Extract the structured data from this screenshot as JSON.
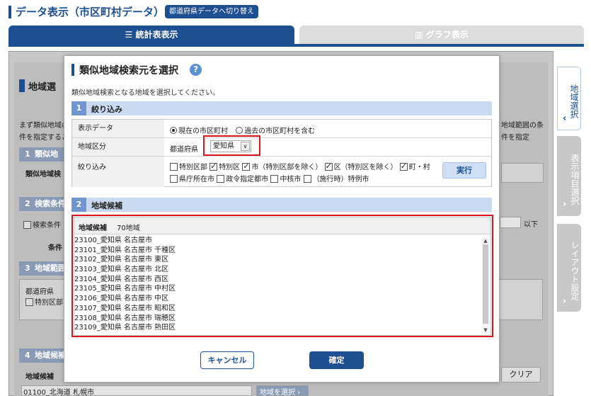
{
  "header": {
    "title": "データ表示（市区町村データ）",
    "switch_label": "都道府県データへ切り替え"
  },
  "tabs": [
    {
      "label": "統計表表示",
      "icon": "table-icon",
      "active": true
    },
    {
      "label": "グラフ表示",
      "icon": "bar-chart-icon",
      "active": false
    }
  ],
  "side_tabs": [
    {
      "label": "地域選択",
      "active": true
    },
    {
      "label": "表示項目選択",
      "active": false
    },
    {
      "label": "レイアウト設定",
      "active": false
    }
  ],
  "background": {
    "section_title": "地域選",
    "desc1": "まず類似地域の",
    "desc2": "件を指定するこ",
    "desc_right1": "地域範囲の条",
    "desc_right2": "件を指定",
    "sec1": {
      "num": "1",
      "label": "類似地"
    },
    "sec1_row": "類似地域検",
    "sec2": {
      "num": "2",
      "label": "検索条件"
    },
    "sec2_row": "検索条件",
    "cond_label": "条件",
    "right_suffix": "以下",
    "sec3": {
      "num": "3",
      "label": "地域範囲"
    },
    "prefecture_label": "都道府県",
    "special_ward": "特別区部",
    "sec4": {
      "num": "4",
      "label": "地域候補"
    },
    "cand_label": "地域候補",
    "clear_label": "クリア",
    "list_item": "01100_北海道 札幌市",
    "select_area_label": "地域を選択 ›"
  },
  "modal": {
    "title": "類似地域検索元を選択",
    "help_icon": "?",
    "description": "類似地域検索となる地域を選択してください。",
    "filter_section": {
      "num": "1",
      "label": "絞り込み"
    },
    "rows": {
      "display_data": {
        "label": "表示データ",
        "options": [
          "現在の市区町村",
          "過去の市区町村を含む"
        ],
        "selected": "現在の市区町村"
      },
      "area_type": {
        "label": "地域区分",
        "prefix": "都道府県",
        "selected": "愛知県"
      },
      "filter": {
        "label": "絞り込み",
        "checks_row1": [
          {
            "label": "特別区部",
            "checked": false
          },
          {
            "label": "特別区",
            "checked": true
          },
          {
            "label": "市（特別区部を除く）",
            "checked": true
          },
          {
            "label": "区（特別区を除く）",
            "checked": true
          },
          {
            "label": "町・村",
            "checked": true
          }
        ],
        "checks_row2": [
          {
            "label": "県庁所在市",
            "checked": false
          },
          {
            "label": "政令指定都市",
            "checked": false
          },
          {
            "label": "中核市",
            "checked": false
          },
          {
            "label": "（施行時）特例市",
            "checked": false
          }
        ],
        "exec_label": "実行"
      }
    },
    "candidate_section": {
      "num": "2",
      "label": "地域候補"
    },
    "candidates": {
      "header": "地域候補",
      "count": "70地域",
      "items": [
        "23100_愛知県 名古屋市",
        "23101_愛知県 名古屋市 千種区",
        "23102_愛知県 名古屋市 東区",
        "23103_愛知県 名古屋市 北区",
        "23104_愛知県 名古屋市 西区",
        "23105_愛知県 名古屋市 中村区",
        "23106_愛知県 名古屋市 中区",
        "23107_愛知県 名古屋市 昭和区",
        "23108_愛知県 名古屋市 瑞穂区",
        "23109_愛知県 名古屋市 熱田区"
      ]
    },
    "cancel_label": "キャンセル",
    "ok_label": "確定"
  },
  "colors": {
    "primary": "#1d4f91",
    "highlight": "#d8141c",
    "section_bg": "#c9daf2"
  }
}
